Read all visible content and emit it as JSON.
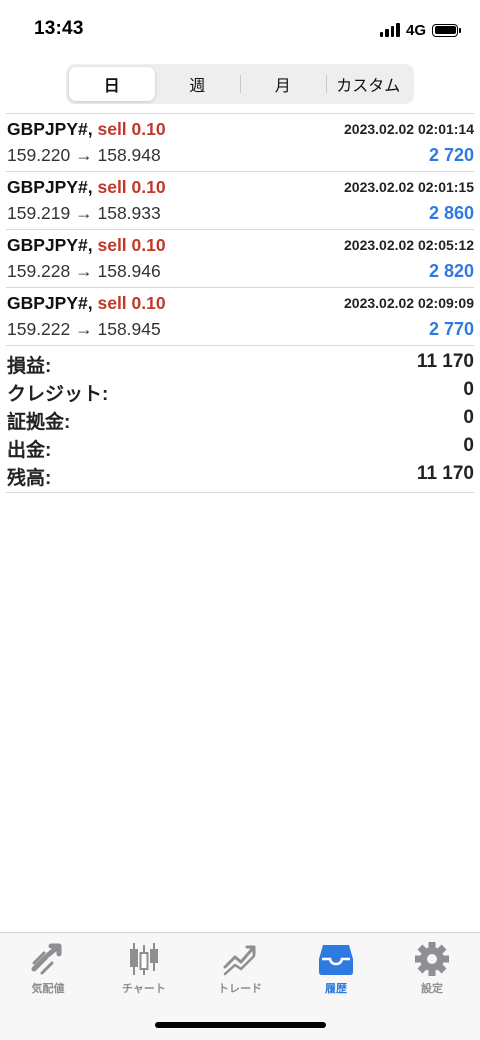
{
  "status_bar": {
    "time": "13:43",
    "network": "4G"
  },
  "period_tabs": [
    {
      "label": "日",
      "active": true
    },
    {
      "label": "週",
      "active": false
    },
    {
      "label": "月",
      "active": false
    },
    {
      "label": "カスタム",
      "active": false
    }
  ],
  "deals": [
    {
      "symbol": "GBPJPY#,",
      "action": "sell 0.10",
      "time": "2023.02.02 02:01:14",
      "prices": "159.220 → 158.948",
      "profit": "2 720"
    },
    {
      "symbol": "GBPJPY#,",
      "action": "sell 0.10",
      "time": "2023.02.02 02:01:15",
      "prices": "159.219 → 158.933",
      "profit": "2 860"
    },
    {
      "symbol": "GBPJPY#,",
      "action": "sell 0.10",
      "time": "2023.02.02 02:05:12",
      "prices": "159.228 → 158.946",
      "profit": "2 820"
    },
    {
      "symbol": "GBPJPY#,",
      "action": "sell 0.10",
      "time": "2023.02.02 02:09:09",
      "prices": "159.222 → 158.945",
      "profit": "2 770"
    }
  ],
  "summary": [
    {
      "label": "損益:",
      "value": "11 170"
    },
    {
      "label": "クレジット:",
      "value": "0"
    },
    {
      "label": "証拠金:",
      "value": "0"
    },
    {
      "label": "出金:",
      "value": "0"
    },
    {
      "label": "残高:",
      "value": "11 170"
    }
  ],
  "tab_bar": [
    {
      "label": "気配値",
      "icon": "quotes-icon",
      "active": false
    },
    {
      "label": "チャート",
      "icon": "chart-icon",
      "active": false
    },
    {
      "label": "トレード",
      "icon": "trade-icon",
      "active": false
    },
    {
      "label": "履歴",
      "icon": "history-icon",
      "active": true
    },
    {
      "label": "設定",
      "icon": "settings-icon",
      "active": false
    }
  ],
  "colors": {
    "accent": "#2f7ae0",
    "sell": "#c0392b",
    "inactive_tab": "#8e8e93"
  }
}
